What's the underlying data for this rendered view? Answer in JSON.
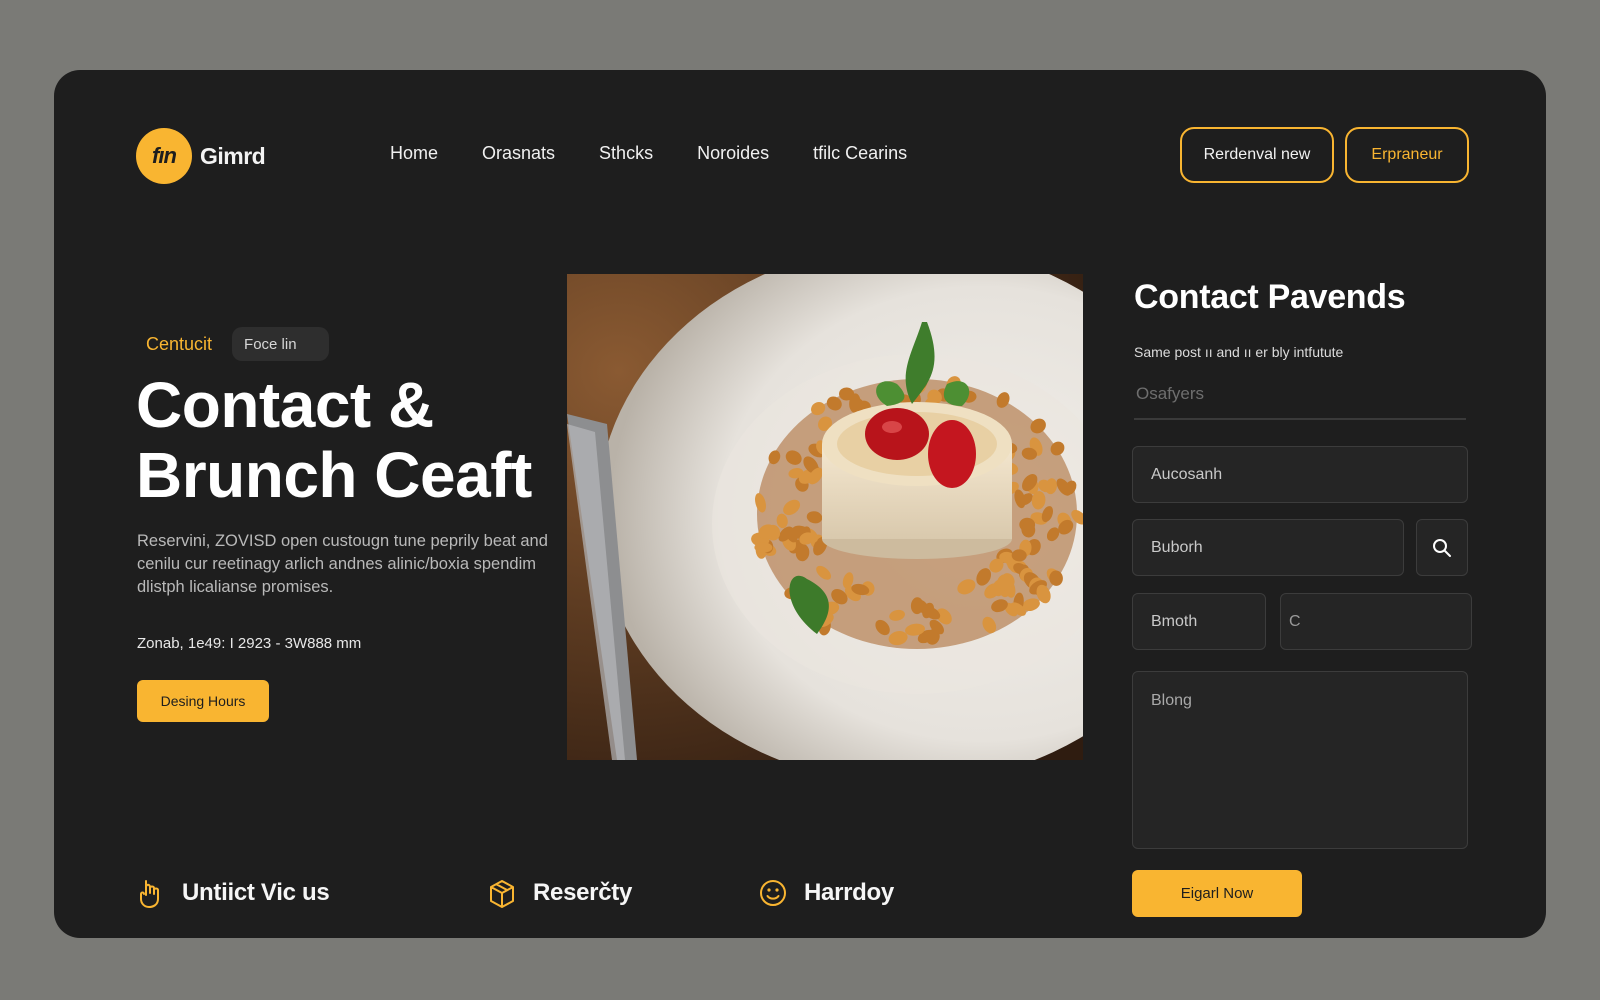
{
  "brand": {
    "mark": "fın",
    "name": "Gimrd"
  },
  "nav": {
    "items": [
      "Home",
      "Orasnats",
      "Sthcks",
      "Noroides",
      "tfilc Cearins"
    ]
  },
  "header_buttons": {
    "primary": "Rerdenval new",
    "secondary": "Erpraneur"
  },
  "hero": {
    "eyebrow": "Centucit",
    "chip": "Foce lin",
    "title_line1": "Contact &",
    "title_line2": "Brunch Ceaft",
    "description": "Reservini, ZOVISD open custougn tune peprily beat and cenilu cur reetinagy  arlich andnes alinic/boxia spendim dlistph licalianse promises.",
    "meta": "Zonab, 1e49:  I  2923 - 3W888 mm",
    "cta": "Desing Hours"
  },
  "form": {
    "title": "Contact Pavends",
    "subtitle": "Same post ıı and ıı er bly intfutute",
    "underline_placeholder": "Osafyers",
    "field1_placeholder": "Aucosanh",
    "field2_placeholder": "Buborh",
    "field3_placeholder": "Bmoth",
    "field4_placeholder": "C",
    "message_placeholder": "Blong",
    "submit": "Eigarl Now"
  },
  "features": [
    {
      "icon": "hand-icon",
      "label": "Untiict Vic us"
    },
    {
      "icon": "box-icon",
      "label": "Reserčty"
    },
    {
      "icon": "smiley-icon",
      "label": "Harrdoy"
    }
  ],
  "colors": {
    "accent": "#f9b531",
    "card": "#1e1e1e",
    "backdrop": "#7a7a76"
  }
}
